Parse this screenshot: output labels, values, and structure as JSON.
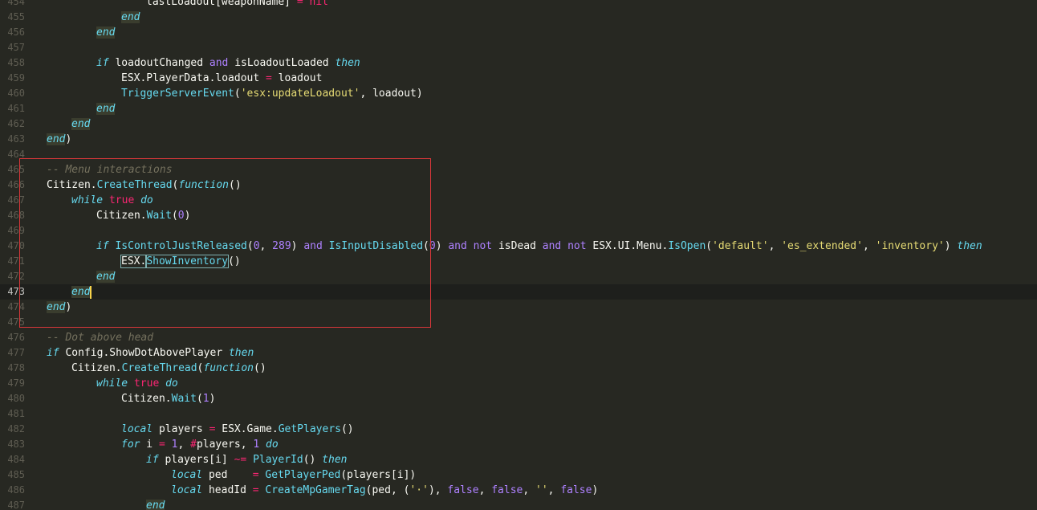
{
  "editor": {
    "current_line": "473",
    "lines": [
      {
        "num": "454",
        "indent": 4,
        "tokens": [
          {
            "t": "lastLoadout[weaponName] ",
            "c": "plain"
          },
          {
            "t": "=",
            "c": "op"
          },
          {
            "t": " nil",
            "c": "kw"
          }
        ]
      },
      {
        "num": "455",
        "indent": 3,
        "tokens": [
          {
            "t": "end",
            "c": "end"
          }
        ]
      },
      {
        "num": "456",
        "indent": 2,
        "tokens": [
          {
            "t": "end",
            "c": "end"
          }
        ]
      },
      {
        "num": "457",
        "indent": 0,
        "tokens": []
      },
      {
        "num": "458",
        "indent": 2,
        "tokens": [
          {
            "t": "if",
            "c": "kwi"
          },
          {
            "t": " loadoutChanged ",
            "c": "plain"
          },
          {
            "t": "and",
            "c": "op2"
          },
          {
            "t": " isLoadoutLoaded ",
            "c": "plain"
          },
          {
            "t": "then",
            "c": "kwi"
          }
        ]
      },
      {
        "num": "459",
        "indent": 3,
        "tokens": [
          {
            "t": "ESX.PlayerData.loadout ",
            "c": "plain"
          },
          {
            "t": "=",
            "c": "op"
          },
          {
            "t": " loadout",
            "c": "plain"
          }
        ]
      },
      {
        "num": "460",
        "indent": 3,
        "tokens": [
          {
            "t": "TriggerServerEvent",
            "c": "fn"
          },
          {
            "t": "(",
            "c": "plain"
          },
          {
            "t": "'esx:updateLoadout'",
            "c": "str"
          },
          {
            "t": ", loadout)",
            "c": "plain"
          }
        ]
      },
      {
        "num": "461",
        "indent": 2,
        "tokens": [
          {
            "t": "end",
            "c": "end"
          }
        ]
      },
      {
        "num": "462",
        "indent": 1,
        "tokens": [
          {
            "t": "end",
            "c": "end"
          }
        ]
      },
      {
        "num": "463",
        "indent": 0,
        "tokens": [
          {
            "t": "end",
            "c": "end"
          },
          {
            "t": ")",
            "c": "plain"
          }
        ]
      },
      {
        "num": "464",
        "indent": 0,
        "tokens": []
      },
      {
        "num": "465",
        "indent": 0,
        "tokens": [
          {
            "t": "-- Menu interactions",
            "c": "com"
          }
        ]
      },
      {
        "num": "466",
        "indent": 0,
        "tokens": [
          {
            "t": "Citizen.",
            "c": "plain"
          },
          {
            "t": "CreateThread",
            "c": "fn"
          },
          {
            "t": "(",
            "c": "plain"
          },
          {
            "t": "function",
            "c": "kwi"
          },
          {
            "t": "()",
            "c": "plain"
          }
        ]
      },
      {
        "num": "467",
        "indent": 1,
        "tokens": [
          {
            "t": "while",
            "c": "kwi"
          },
          {
            "t": " true",
            "c": "kw"
          },
          {
            "t": " do",
            "c": "kwi"
          }
        ]
      },
      {
        "num": "468",
        "indent": 2,
        "tokens": [
          {
            "t": "Citizen.",
            "c": "plain"
          },
          {
            "t": "Wait",
            "c": "fn"
          },
          {
            "t": "(",
            "c": "plain"
          },
          {
            "t": "0",
            "c": "num"
          },
          {
            "t": ")",
            "c": "plain"
          }
        ]
      },
      {
        "num": "469",
        "indent": 0,
        "tokens": []
      },
      {
        "num": "470",
        "indent": 2,
        "tokens": [
          {
            "t": "if",
            "c": "kwi"
          },
          {
            "t": " ",
            "c": "plain"
          },
          {
            "t": "IsControlJustReleased",
            "c": "fn"
          },
          {
            "t": "(",
            "c": "plain"
          },
          {
            "t": "0",
            "c": "num"
          },
          {
            "t": ", ",
            "c": "plain"
          },
          {
            "t": "289",
            "c": "num"
          },
          {
            "t": ") ",
            "c": "plain"
          },
          {
            "t": "and",
            "c": "op2"
          },
          {
            "t": " ",
            "c": "plain"
          },
          {
            "t": "IsInputDisabled",
            "c": "fn"
          },
          {
            "t": "(",
            "c": "plain"
          },
          {
            "t": "0",
            "c": "num"
          },
          {
            "t": ") ",
            "c": "plain"
          },
          {
            "t": "and not",
            "c": "op2"
          },
          {
            "t": " isDead ",
            "c": "plain"
          },
          {
            "t": "and not",
            "c": "op2"
          },
          {
            "t": " ESX.UI.Menu.",
            "c": "plain"
          },
          {
            "t": "IsOpen",
            "c": "fn"
          },
          {
            "t": "(",
            "c": "plain"
          },
          {
            "t": "'default'",
            "c": "str"
          },
          {
            "t": ", ",
            "c": "plain"
          },
          {
            "t": "'es_extended'",
            "c": "str"
          },
          {
            "t": ", ",
            "c": "plain"
          },
          {
            "t": "'inventory'",
            "c": "str"
          },
          {
            "t": ") ",
            "c": "plain"
          },
          {
            "t": "then",
            "c": "kwi"
          }
        ]
      },
      {
        "num": "471",
        "indent": 3,
        "tokens": [
          {
            "t": "ESX.",
            "c": "plain-hl"
          },
          {
            "t": "ShowInventory",
            "c": "fn-hl"
          },
          {
            "t": "()",
            "c": "plain"
          }
        ]
      },
      {
        "num": "472",
        "indent": 2,
        "tokens": [
          {
            "t": "end",
            "c": "end"
          }
        ]
      },
      {
        "num": "473",
        "indent": 1,
        "tokens": [
          {
            "t": "end",
            "c": "end"
          },
          {
            "t": "",
            "c": "caret"
          }
        ]
      },
      {
        "num": "474",
        "indent": 0,
        "tokens": [
          {
            "t": "end",
            "c": "end"
          },
          {
            "t": ")",
            "c": "plain"
          }
        ]
      },
      {
        "num": "475",
        "indent": 0,
        "tokens": []
      },
      {
        "num": "476",
        "indent": 0,
        "tokens": [
          {
            "t": "-- Dot above head",
            "c": "com"
          }
        ]
      },
      {
        "num": "477",
        "indent": 0,
        "tokens": [
          {
            "t": "if",
            "c": "kwi"
          },
          {
            "t": " Config.ShowDotAbovePlayer ",
            "c": "plain"
          },
          {
            "t": "then",
            "c": "kwi"
          }
        ]
      },
      {
        "num": "478",
        "indent": 1,
        "tokens": [
          {
            "t": "Citizen.",
            "c": "plain"
          },
          {
            "t": "CreateThread",
            "c": "fn"
          },
          {
            "t": "(",
            "c": "plain"
          },
          {
            "t": "function",
            "c": "kwi"
          },
          {
            "t": "()",
            "c": "plain"
          }
        ]
      },
      {
        "num": "479",
        "indent": 2,
        "tokens": [
          {
            "t": "while",
            "c": "kwi"
          },
          {
            "t": " true",
            "c": "kw"
          },
          {
            "t": " do",
            "c": "kwi"
          }
        ]
      },
      {
        "num": "480",
        "indent": 3,
        "tokens": [
          {
            "t": "Citizen.",
            "c": "plain"
          },
          {
            "t": "Wait",
            "c": "fn"
          },
          {
            "t": "(",
            "c": "plain"
          },
          {
            "t": "1",
            "c": "num"
          },
          {
            "t": ")",
            "c": "plain"
          }
        ]
      },
      {
        "num": "481",
        "indent": 0,
        "tokens": []
      },
      {
        "num": "482",
        "indent": 3,
        "tokens": [
          {
            "t": "local",
            "c": "kwi"
          },
          {
            "t": " players ",
            "c": "plain"
          },
          {
            "t": "=",
            "c": "op"
          },
          {
            "t": " ESX.Game.",
            "c": "plain"
          },
          {
            "t": "GetPlayers",
            "c": "fn"
          },
          {
            "t": "()",
            "c": "plain"
          }
        ]
      },
      {
        "num": "483",
        "indent": 3,
        "tokens": [
          {
            "t": "for",
            "c": "kwi"
          },
          {
            "t": " i ",
            "c": "plain"
          },
          {
            "t": "=",
            "c": "op"
          },
          {
            "t": " ",
            "c": "plain"
          },
          {
            "t": "1",
            "c": "num"
          },
          {
            "t": ", ",
            "c": "plain"
          },
          {
            "t": "#",
            "c": "op"
          },
          {
            "t": "players, ",
            "c": "plain"
          },
          {
            "t": "1",
            "c": "num"
          },
          {
            "t": " do",
            "c": "kwi"
          }
        ]
      },
      {
        "num": "484",
        "indent": 4,
        "tokens": [
          {
            "t": "if",
            "c": "kwi"
          },
          {
            "t": " players[i] ",
            "c": "plain"
          },
          {
            "t": "~=",
            "c": "op"
          },
          {
            "t": " ",
            "c": "plain"
          },
          {
            "t": "PlayerId",
            "c": "fn"
          },
          {
            "t": "() ",
            "c": "plain"
          },
          {
            "t": "then",
            "c": "kwi"
          }
        ]
      },
      {
        "num": "485",
        "indent": 5,
        "tokens": [
          {
            "t": "local",
            "c": "kwi"
          },
          {
            "t": " ped    ",
            "c": "plain"
          },
          {
            "t": "=",
            "c": "op"
          },
          {
            "t": " ",
            "c": "plain"
          },
          {
            "t": "GetPlayerPed",
            "c": "fn"
          },
          {
            "t": "(players[i])",
            "c": "plain"
          }
        ]
      },
      {
        "num": "486",
        "indent": 5,
        "tokens": [
          {
            "t": "local",
            "c": "kwi"
          },
          {
            "t": " headId ",
            "c": "plain"
          },
          {
            "t": "=",
            "c": "op"
          },
          {
            "t": " ",
            "c": "plain"
          },
          {
            "t": "CreateMpGamerTag",
            "c": "fn"
          },
          {
            "t": "(ped, (",
            "c": "plain"
          },
          {
            "t": "'·'",
            "c": "str"
          },
          {
            "t": "), ",
            "c": "plain"
          },
          {
            "t": "false",
            "c": "bool"
          },
          {
            "t": ", ",
            "c": "plain"
          },
          {
            "t": "false",
            "c": "bool"
          },
          {
            "t": ", ",
            "c": "plain"
          },
          {
            "t": "''",
            "c": "str"
          },
          {
            "t": ", ",
            "c": "plain"
          },
          {
            "t": "false",
            "c": "bool"
          },
          {
            "t": ")",
            "c": "plain"
          }
        ]
      },
      {
        "num": "487",
        "indent": 4,
        "tokens": [
          {
            "t": "end",
            "c": "end"
          }
        ]
      }
    ]
  },
  "colors": {
    "background": "#272822",
    "annotation_box": "#d9373a",
    "keyword": "#66d9ef",
    "operator": "#f92672",
    "number": "#ae81ff",
    "string": "#e6db74",
    "comment": "#75715e"
  }
}
